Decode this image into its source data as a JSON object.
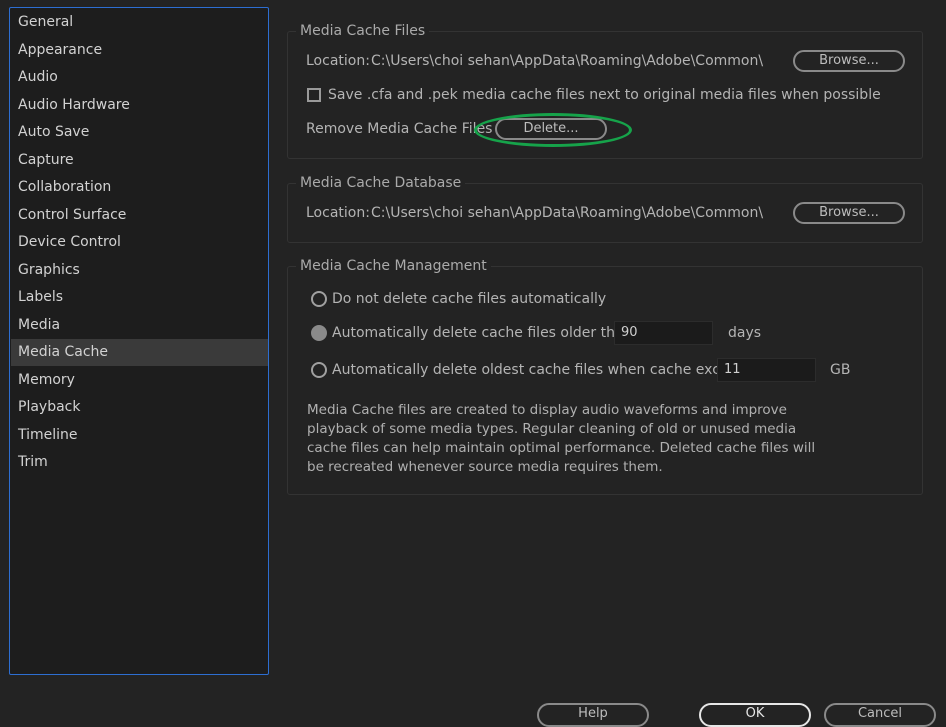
{
  "sidebar": {
    "items": [
      {
        "label": "General"
      },
      {
        "label": "Appearance"
      },
      {
        "label": "Audio"
      },
      {
        "label": "Audio Hardware"
      },
      {
        "label": "Auto Save"
      },
      {
        "label": "Capture"
      },
      {
        "label": "Collaboration"
      },
      {
        "label": "Control Surface"
      },
      {
        "label": "Device Control"
      },
      {
        "label": "Graphics"
      },
      {
        "label": "Labels"
      },
      {
        "label": "Media"
      },
      {
        "label": "Media Cache"
      },
      {
        "label": "Memory"
      },
      {
        "label": "Playback"
      },
      {
        "label": "Timeline"
      },
      {
        "label": "Trim"
      }
    ],
    "selected": "Media Cache"
  },
  "cache_files": {
    "title": "Media Cache Files",
    "location_label": "Location:",
    "location_path": "C:\\Users\\choi sehan\\AppData\\Roaming\\Adobe\\Common\\",
    "browse_label": "Browse...",
    "save_next_label": "Save .cfa and .pek media cache files next to original media files when possible",
    "save_next_checked": false,
    "remove_label": "Remove Media Cache Files",
    "delete_label": "Delete..."
  },
  "cache_db": {
    "title": "Media Cache Database",
    "location_label": "Location:",
    "location_path": "C:\\Users\\choi sehan\\AppData\\Roaming\\Adobe\\Common\\",
    "browse_label": "Browse..."
  },
  "cache_mgmt": {
    "title": "Media Cache Management",
    "option_no_delete": "Do not delete cache files automatically",
    "option_older_than": "Automatically delete cache files older than:",
    "older_than_value": "90",
    "older_than_unit": "days",
    "option_exceeds": "Automatically delete oldest cache files when cache exceeds:",
    "exceeds_value": "11",
    "exceeds_unit": "GB",
    "description": "Media Cache files are created to display audio waveforms and improve playback of some media types.  Regular cleaning of old or unused media cache files can help maintain optimal performance. Deleted cache files will be recreated whenever source media requires them."
  },
  "footer": {
    "help_label": "Help",
    "ok_label": "OK",
    "cancel_label": "Cancel"
  },
  "colors": {
    "background": "#232323",
    "sidebar_border": "#2d6ed1",
    "highlight_annotation": "#16a34a"
  }
}
